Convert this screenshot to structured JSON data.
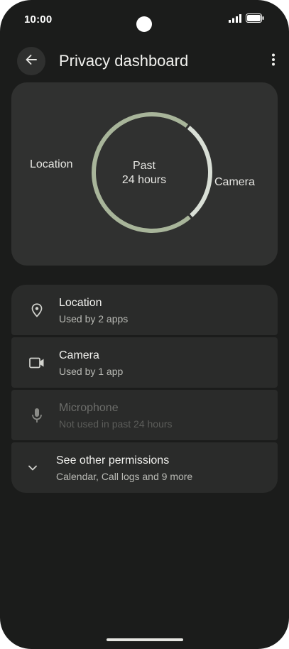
{
  "status_bar": {
    "time": "10:00",
    "icons": [
      "signal-icon",
      "battery-icon"
    ]
  },
  "app_bar": {
    "back_icon": "arrow-left-icon",
    "title": "Privacy dashboard",
    "more_icon": "more-vert-icon"
  },
  "chart_data": {
    "type": "pie",
    "center_label_line1": "Past",
    "center_label_line2": "24 hours",
    "categories": [
      "Location",
      "Camera"
    ],
    "values": [
      0.72,
      0.28
    ],
    "colors": [
      "#a8b59a",
      "#d9dfd6"
    ]
  },
  "permissions": [
    {
      "icon": "location-pin-icon",
      "title": "Location",
      "subtitle": "Used by 2 apps",
      "enabled": true
    },
    {
      "icon": "videocam-icon",
      "title": "Camera",
      "subtitle": "Used by 1 app",
      "enabled": true
    },
    {
      "icon": "microphone-icon",
      "title": "Microphone",
      "subtitle": "Not used in past 24 hours",
      "enabled": false
    },
    {
      "icon": "chevron-down-icon",
      "title": "See other permissions",
      "subtitle": "Calendar, Call logs and 9 more",
      "enabled": true
    }
  ],
  "colors": {
    "background": "#1b1c1b",
    "card": "#303130",
    "row": "#2a2b2a",
    "accent_location": "#a8b59a",
    "accent_camera": "#d9dfd6"
  }
}
